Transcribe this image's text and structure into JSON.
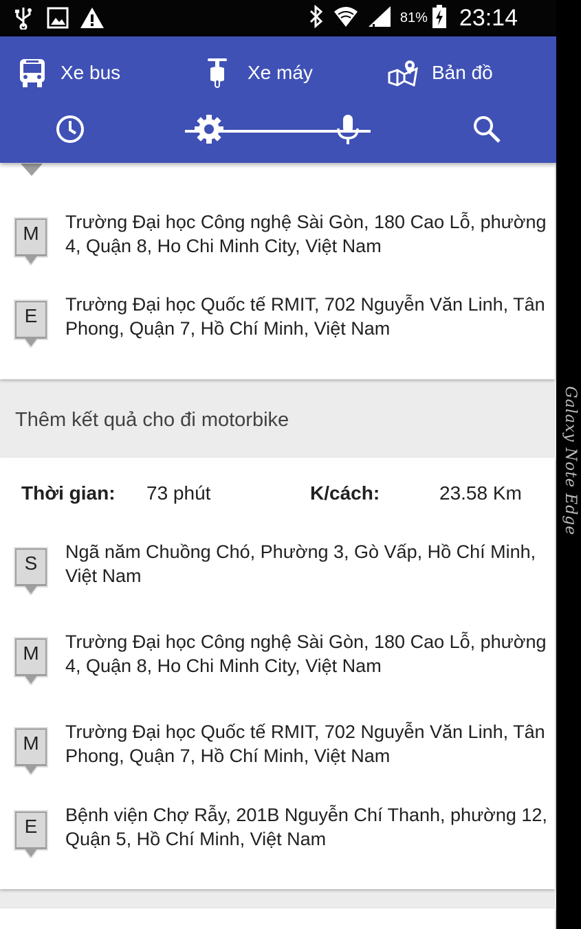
{
  "status_bar": {
    "icons_left": [
      "usb-icon",
      "image-icon",
      "warning-icon"
    ],
    "icons_right": [
      "bluetooth-icon",
      "wifi-icon",
      "signal-icon"
    ],
    "battery": "81%",
    "time": "23:14"
  },
  "tabs": [
    {
      "label": "Xe bus",
      "icon": "bus-icon",
      "selected": false
    },
    {
      "label": "Xe máy",
      "icon": "scooter-icon",
      "selected": true
    },
    {
      "label": "Bản đồ",
      "icon": "map-icon",
      "selected": false
    }
  ],
  "actions": [
    "clock-icon",
    "settings-icon",
    "mic-icon",
    "search-icon"
  ],
  "theme": {
    "primary": "#3f51b5",
    "background": "#ececec",
    "marker": "#9e9e9e"
  },
  "route1": {
    "stops": [
      {
        "marker": "M",
        "address": "Trường Đại học Công nghệ Sài Gòn, 180 Cao Lỗ, phường 4, Quận 8, Ho Chi Minh City, Việt Nam"
      },
      {
        "marker": "E",
        "address": "Trường Đại học Quốc tế RMIT, 702 Nguyễn Văn Linh, Tân Phong, Quận 7, Hồ Chí Minh, Việt Nam"
      }
    ]
  },
  "more_results_label": "Thêm kết quả cho đi motorbike",
  "route2": {
    "time_label": "Thời gian:",
    "time_value": "73 phút",
    "distance_label": "K/cách:",
    "distance_value": "23.58 Km",
    "stops": [
      {
        "marker": "S",
        "address": "Ngã năm Chuồng Chó, Phường 3, Gò Vấp, Hồ Chí Minh, Việt Nam"
      },
      {
        "marker": "M",
        "address": "Trường Đại học Công nghệ Sài Gòn, 180 Cao Lỗ, phường 4, Quận 8, Ho Chi Minh City, Việt Nam"
      },
      {
        "marker": "M",
        "address": "Trường Đại học Quốc tế RMIT, 702 Nguyễn Văn Linh, Tân Phong, Quận 7, Hồ Chí Minh, Việt Nam"
      },
      {
        "marker": "E",
        "address": "Bệnh viện Chợ Rẫy, 201B Nguyễn Chí Thanh, phường 12, Quận 5, Hồ Chí Minh, Việt Nam"
      }
    ]
  },
  "device_edge_label": "Galaxy Note Edge"
}
